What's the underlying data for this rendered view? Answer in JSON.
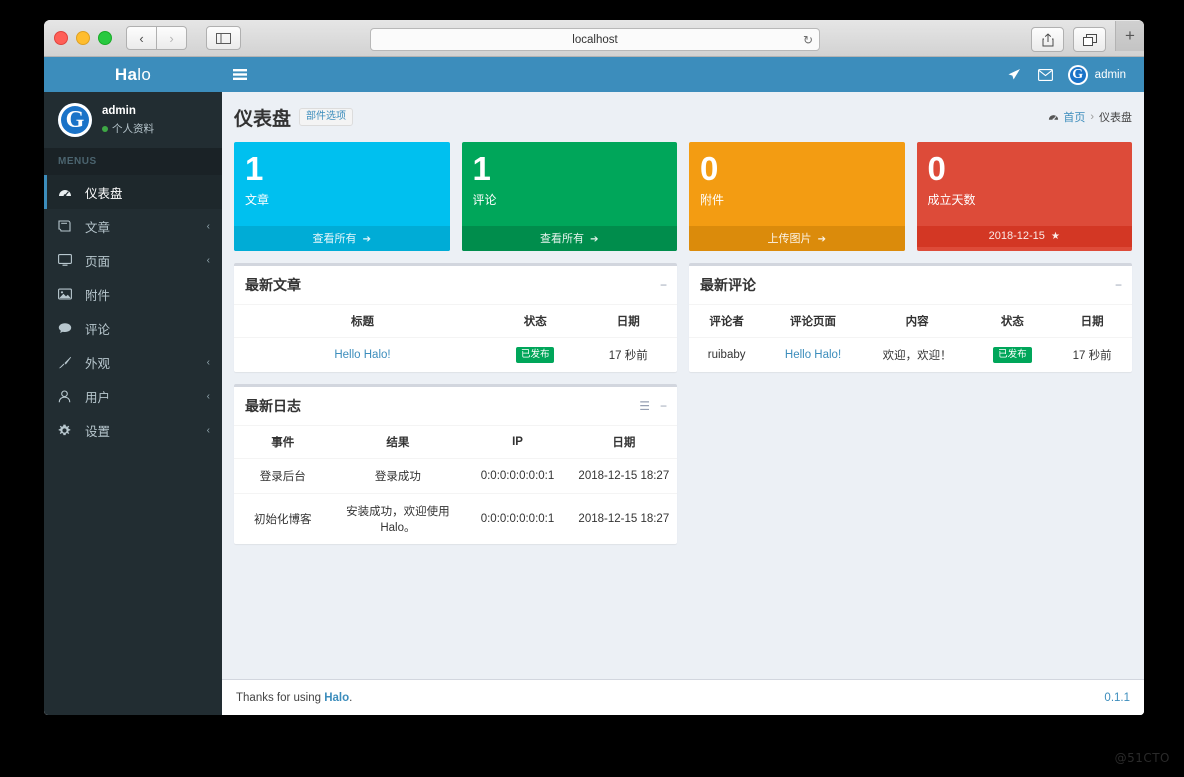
{
  "browser": {
    "url": "localhost",
    "reload_icon": "reload-icon",
    "back_icon": "‹",
    "forward_icon": "›",
    "sidebar_icon": "sidebar-toggle-icon",
    "share_icon": "share-icon",
    "tabs_icon": "tabs-overview-icon",
    "new_tab_label": "+"
  },
  "sidebar": {
    "logo_bold": "Ha",
    "logo_thin": "lo",
    "user": {
      "name": "admin",
      "status": "个人资料",
      "avatar_letter": "G"
    },
    "menus_header": "MENUS",
    "items": [
      {
        "label": "仪表盘",
        "icon": "dashboard-icon",
        "active": true,
        "chevron": ""
      },
      {
        "label": "文章",
        "icon": "book-icon",
        "active": false,
        "chevron": "‹"
      },
      {
        "label": "页面",
        "icon": "desktop-icon",
        "active": false,
        "chevron": "‹"
      },
      {
        "label": "附件",
        "icon": "image-icon",
        "active": false,
        "chevron": ""
      },
      {
        "label": "评论",
        "icon": "comment-icon",
        "active": false,
        "chevron": ""
      },
      {
        "label": "外观",
        "icon": "brush-icon",
        "active": false,
        "chevron": "‹"
      },
      {
        "label": "用户",
        "icon": "user-icon",
        "active": false,
        "chevron": "‹"
      },
      {
        "label": "设置",
        "icon": "gear-icon",
        "active": false,
        "chevron": "‹"
      }
    ]
  },
  "navbar": {
    "burger_icon": "hamburger-icon",
    "icons": [
      {
        "name": "send-icon",
        "glyph": "➤"
      },
      {
        "name": "mail-icon",
        "glyph": "✉"
      }
    ],
    "user_label": "admin",
    "user_avatar_letter": "G"
  },
  "page": {
    "title": "仪表盘",
    "widget_button": "部件选项",
    "breadcrumb": {
      "home_icon": "dashboard-icon",
      "home": "首页",
      "separator": "›",
      "current": "仪表盘"
    }
  },
  "stat_boxes": [
    {
      "number": "1",
      "label": "文章",
      "footer": "查看所有",
      "footer_icon": "arrow-circle-right-icon",
      "color": "#00c0ef",
      "footer_color": "#00acd6"
    },
    {
      "number": "1",
      "label": "评论",
      "footer": "查看所有",
      "footer_icon": "arrow-circle-right-icon",
      "color": "#00a65a",
      "footer_color": "#008d4c"
    },
    {
      "number": "0",
      "label": "附件",
      "footer": "上传图片",
      "footer_icon": "arrow-circle-right-icon",
      "color": "#f39c12",
      "footer_color": "#db8b0b"
    },
    {
      "number": "0",
      "label": "成立天数",
      "footer": "2018-12-15",
      "footer_icon": "star-icon",
      "color": "#dd4b39",
      "footer_color": "#d33724"
    }
  ],
  "panels": {
    "latest_posts": {
      "title": "最新文章",
      "tools": [
        {
          "name": "collapse-icon",
          "glyph": "−"
        }
      ],
      "columns": [
        "标题",
        "状态",
        "日期"
      ],
      "rows": [
        {
          "title": "Hello Halo!",
          "status": "已发布",
          "date": "17 秒前"
        }
      ]
    },
    "latest_comments": {
      "title": "最新评论",
      "tools": [
        {
          "name": "collapse-icon",
          "glyph": "−"
        }
      ],
      "columns": [
        "评论者",
        "评论页面",
        "内容",
        "状态",
        "日期"
      ],
      "rows": [
        {
          "author": "ruibaby",
          "page": "Hello Halo!",
          "content": "欢迎，欢迎！",
          "status": "已发布",
          "date": "17 秒前"
        }
      ]
    },
    "latest_logs": {
      "title": "最新日志",
      "tools": [
        {
          "name": "list-icon",
          "glyph": "☰"
        },
        {
          "name": "collapse-icon",
          "glyph": "−"
        }
      ],
      "columns": [
        "事件",
        "结果",
        "IP",
        "日期"
      ],
      "rows": [
        {
          "event": "登录后台",
          "result": "登录成功",
          "ip": "0:0:0:0:0:0:0:1",
          "date": "2018-12-15 18:27"
        },
        {
          "event": "初始化博客",
          "result": "安装成功，欢迎使用Halo。",
          "ip": "0:0:0:0:0:0:0:1",
          "date": "2018-12-15 18:27"
        }
      ]
    }
  },
  "footer": {
    "thanks_prefix": "Thanks for using ",
    "brand": "Halo",
    "thanks_suffix": ".",
    "version": "0.1.1"
  },
  "watermark": "@51CTO",
  "colors": {
    "brand_blue": "#3c8dbc",
    "sidebar_dark": "#222d32",
    "content_bg": "#ecf0f5",
    "link": "#3c8dbc",
    "badge_green": "#00a65a"
  }
}
